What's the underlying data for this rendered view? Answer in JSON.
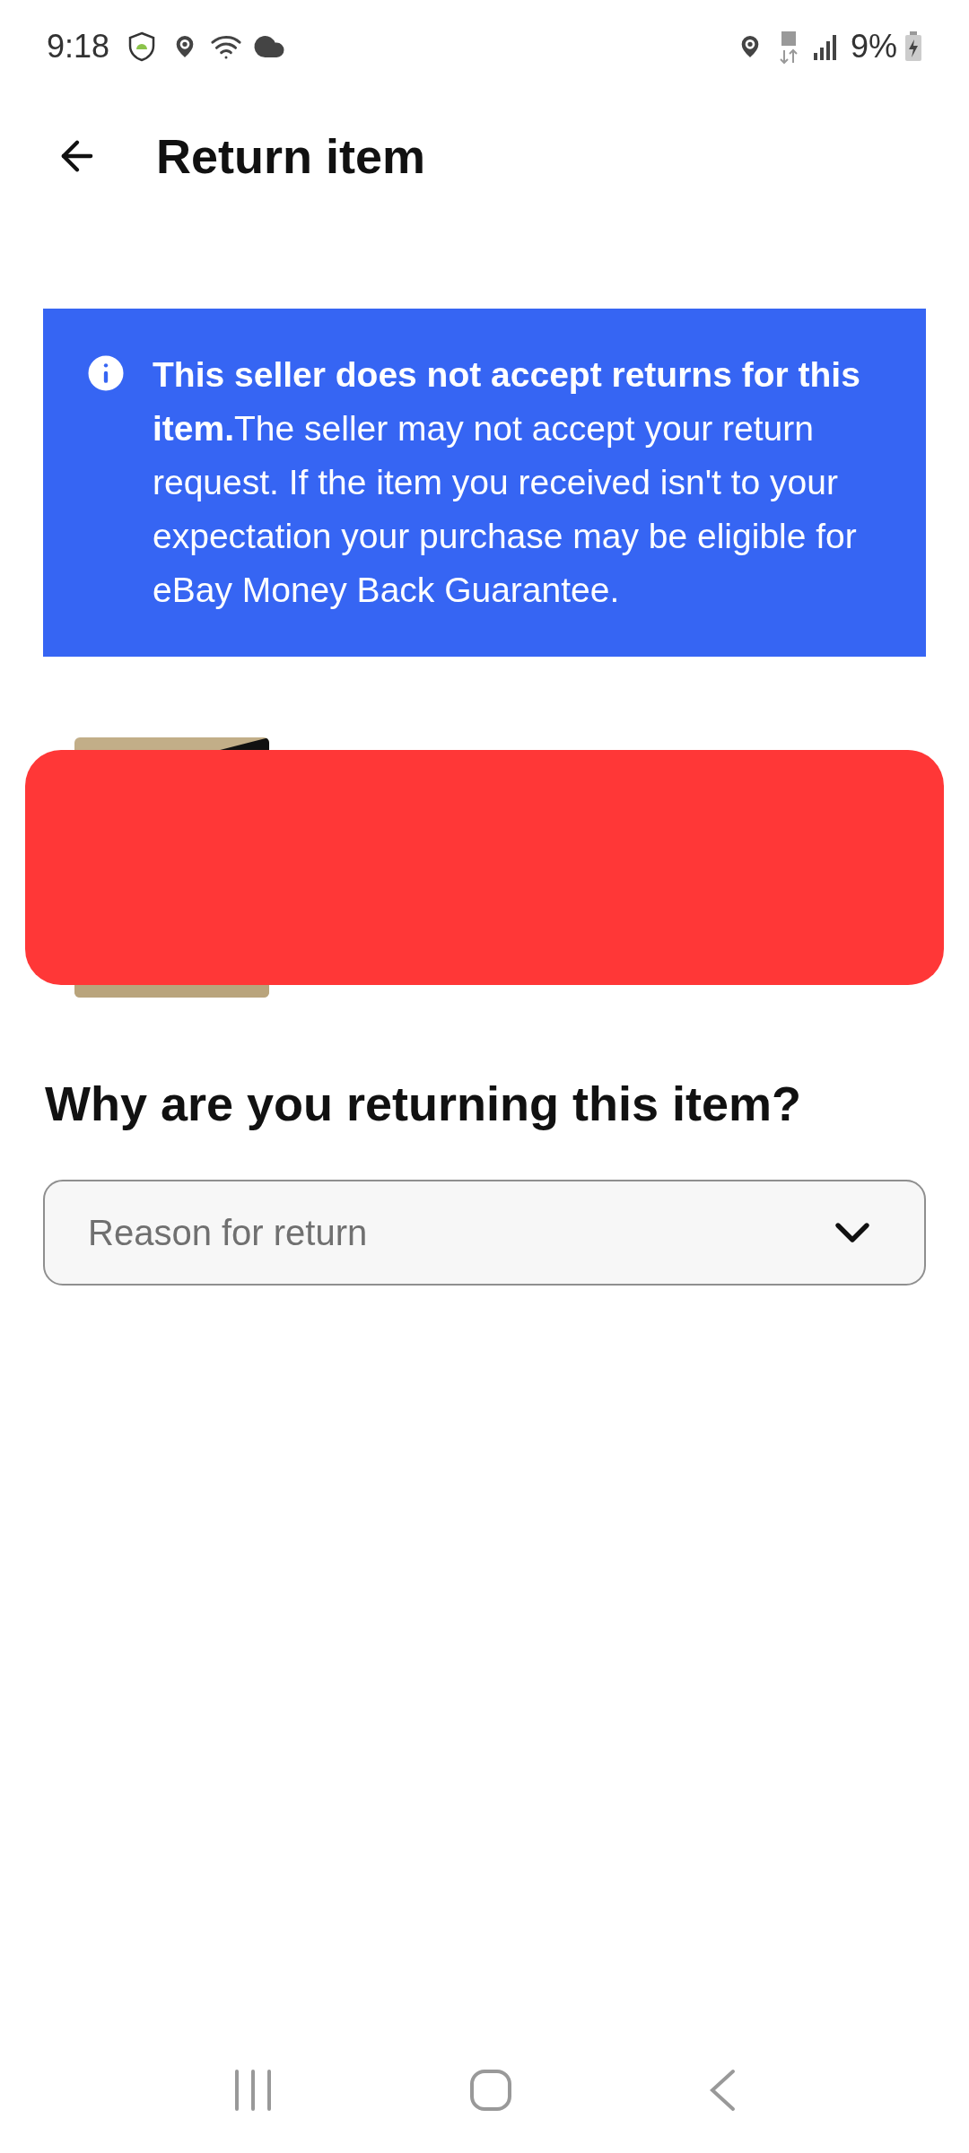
{
  "status_bar": {
    "time": "9:18",
    "battery": "9%"
  },
  "header": {
    "title": "Return item"
  },
  "notice": {
    "text": "**This seller does not accept returns for this item.**The seller may not accept your return request. If the item you received isn't to your expectation your purchase may be eligible for eBay Money Back Guarantee."
  },
  "item": {
    "redacted": true
  },
  "question": {
    "title": "Why are you returning this item?"
  },
  "reason_dropdown": {
    "placeholder": "Reason for return"
  }
}
